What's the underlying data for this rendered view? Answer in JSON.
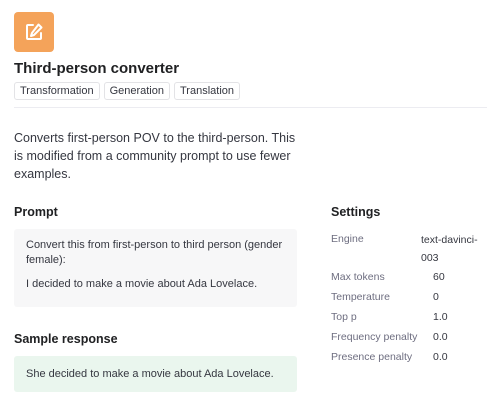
{
  "app": {
    "title": "Third-person converter",
    "tags": [
      "Transformation",
      "Generation",
      "Translation"
    ],
    "description": "Converts first-person POV to the third-person. This is modified from a community prompt to use fewer examples.",
    "icon": "pencil-edit-icon",
    "accent_color": "#f4a35a"
  },
  "prompt": {
    "heading": "Prompt",
    "lines": [
      "Convert this from first-person to third person (gender female):",
      "I decided to make a movie about Ada Lovelace."
    ]
  },
  "sample_response": {
    "heading": "Sample response",
    "text": "She decided to make a movie about Ada Lovelace.",
    "bg_color": "#eaf6ee"
  },
  "settings": {
    "heading": "Settings",
    "engine_label": "Engine",
    "engine_line1": "text-davinci-",
    "engine_line2": "003",
    "rows": [
      {
        "label": "Max tokens",
        "value": "60"
      },
      {
        "label": "Temperature",
        "value": "0"
      },
      {
        "label": "Top p",
        "value": "1.0"
      },
      {
        "label": "Frequency penalty",
        "value": "0.0"
      },
      {
        "label": "Presence penalty",
        "value": "0.0"
      }
    ]
  }
}
